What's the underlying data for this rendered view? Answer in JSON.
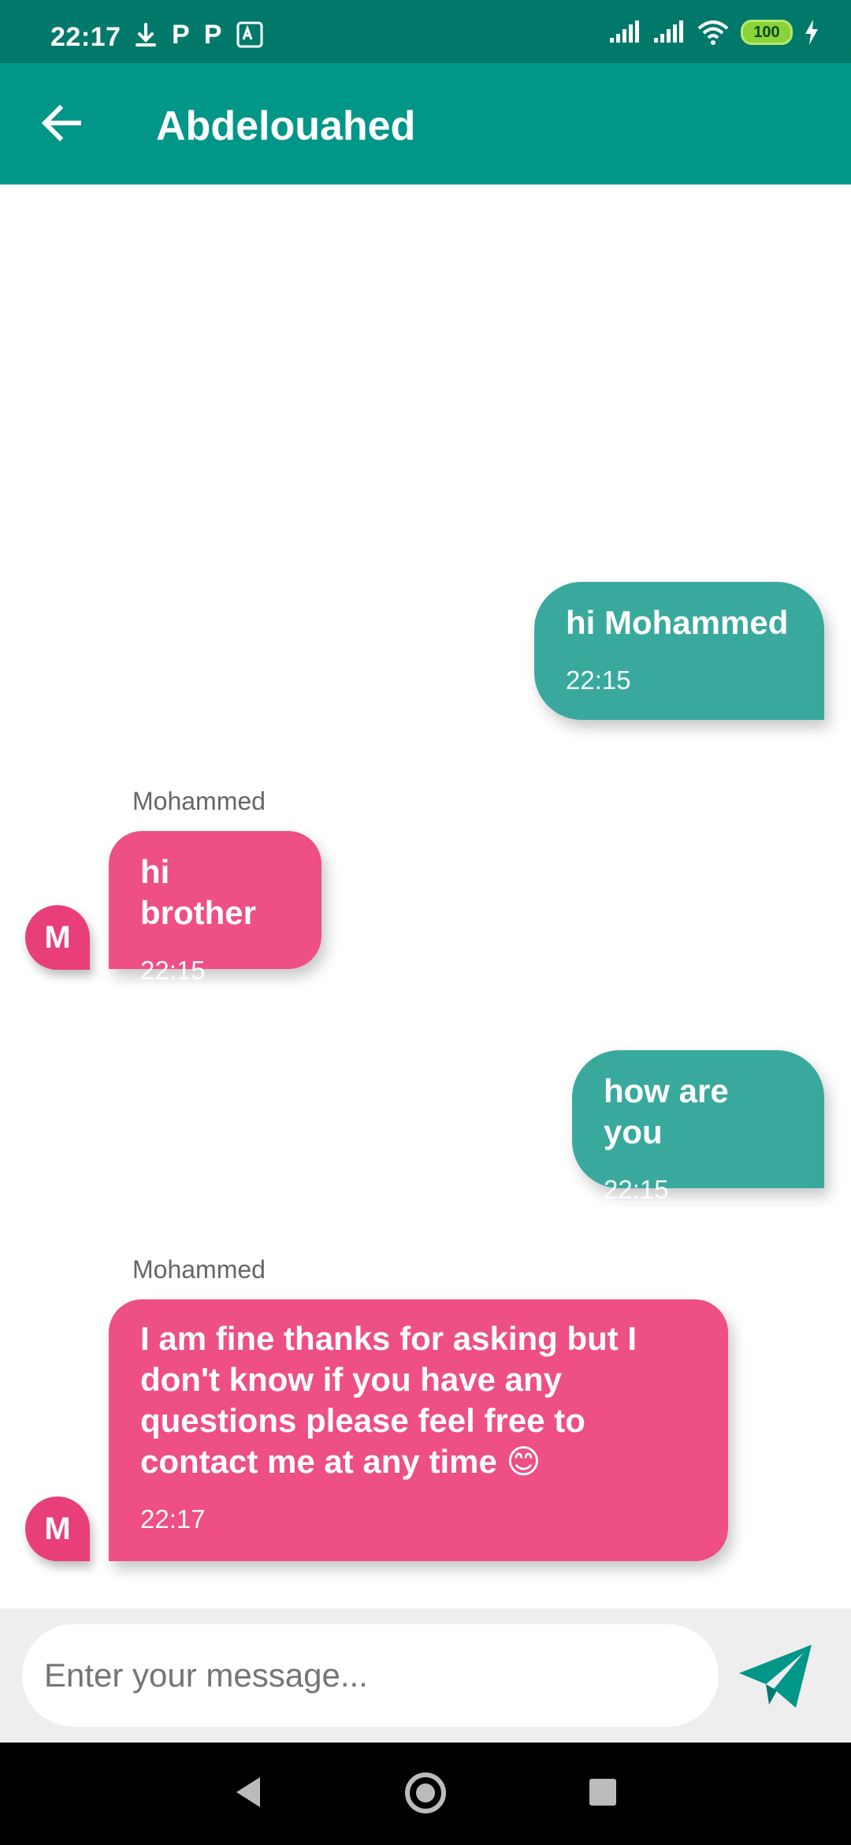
{
  "status_bar": {
    "time": "22:17",
    "left_icons": [
      "download-icon",
      "p-icon",
      "p-icon",
      "translate-icon"
    ],
    "p_glyph": "P",
    "battery": "100",
    "right_icons": [
      "signal-icon",
      "signal-icon",
      "wifi-icon",
      "battery-icon",
      "charging-icon"
    ]
  },
  "app_bar": {
    "title": "Abdelouahed",
    "back_icon": "arrow-left-icon"
  },
  "messages": [
    {
      "direction": "outgoing",
      "text": "hi Mohammed",
      "time": "22:15"
    },
    {
      "direction": "incoming",
      "sender": "Mohammed",
      "avatar_letter": "M",
      "text": "hi brother",
      "time": "22:15"
    },
    {
      "direction": "outgoing",
      "text": "how are you",
      "time": "22:15"
    },
    {
      "direction": "incoming",
      "sender": "Mohammed",
      "avatar_letter": "M",
      "text": "I am fine thanks for asking but I don't know if you have any questions please feel free to contact me at any time 😊",
      "time": "22:17"
    }
  ],
  "input_bar": {
    "placeholder": "Enter your message...",
    "send_icon": "send-icon"
  },
  "colors": {
    "app_bar": "#009688",
    "status_bar": "#00796b",
    "outgoing_bubble": "#39a99e",
    "incoming_bubble": "#ee4f84",
    "send_icon": "#009688"
  },
  "nav_bar": {
    "icons": [
      "back-triangle-icon",
      "home-circle-icon",
      "recents-square-icon"
    ]
  }
}
